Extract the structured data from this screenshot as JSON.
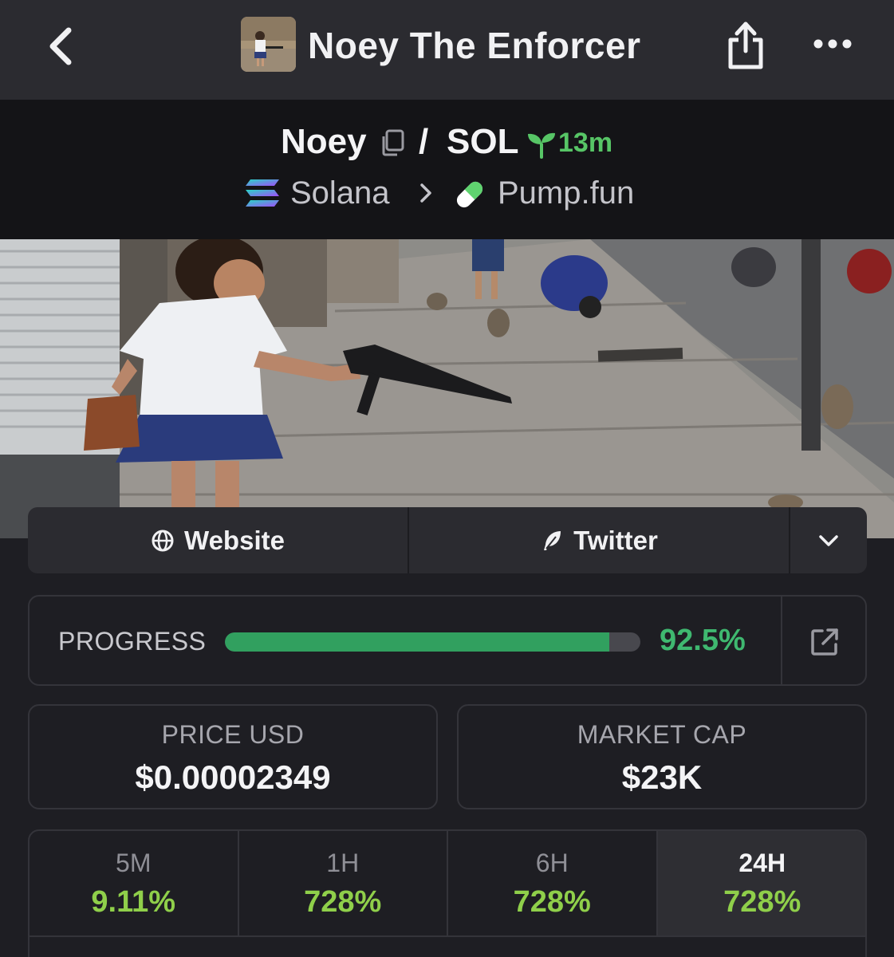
{
  "header": {
    "title": "Noey The Enforcer"
  },
  "pair": {
    "base": "Noey",
    "separator": "/",
    "quote": "SOL",
    "age": "13m",
    "chain": "Solana",
    "dex": "Pump.fun"
  },
  "links": {
    "website_label": "Website",
    "twitter_label": "Twitter"
  },
  "progress": {
    "label": "PROGRESS",
    "value_text": "92.5%",
    "fraction": 0.925
  },
  "stats": {
    "price_label": "PRICE USD",
    "price_value": "$0.00002349",
    "mcap_label": "MARKET CAP",
    "mcap_value": "$23K"
  },
  "changes": [
    {
      "label": "5M",
      "value": "9.11%"
    },
    {
      "label": "1H",
      "value": "728%"
    },
    {
      "label": "6H",
      "value": "728%"
    },
    {
      "label": "24H",
      "value": "728%"
    }
  ],
  "colors": {
    "accent_green": "#3fb870",
    "change_green": "#8fcf4a",
    "age_green": "#57c566"
  },
  "icons": {
    "back": "chevron-left-icon",
    "share": "share-icon",
    "more": "more-dots-icon",
    "copy": "copy-icon",
    "age": "sprout-icon",
    "chain": "solana-icon",
    "dex": "pill-icon",
    "website": "globe-icon",
    "twitter": "feather-icon",
    "expand": "chevron-down-icon",
    "external": "external-link-icon"
  }
}
